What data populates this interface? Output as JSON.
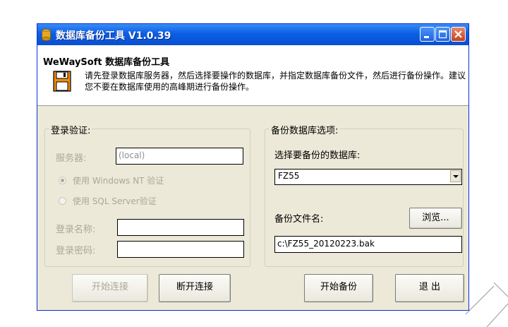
{
  "window": {
    "title": "数据库备份工具 V1.0.39"
  },
  "header": {
    "app_title": "WeWaySoft 数据库备份工具",
    "description": "请先登录数据库服务器，然后选择要操作的数据库，并指定数据库备份文件，然后进行备份操作。建议您不要在数据库使用的高峰期进行备份操作。"
  },
  "login": {
    "legend": "登录验证:",
    "server_label": "服务器:",
    "server_value": "(local)",
    "auth_windows": "使用 Windows NT 验证",
    "auth_sql": "使用 SQL Server验证",
    "username_label": "登录名称:",
    "username_value": "",
    "password_label": "登录密码:",
    "password_value": ""
  },
  "backup": {
    "legend": "备份数据库选项:",
    "select_db_label": "选择要备份的数据库:",
    "selected_db": "FZ55",
    "file_label": "备份文件名:",
    "browse_label": "浏览...",
    "file_value": "c:\\FZ55_20120223.bak"
  },
  "buttons": {
    "connect": "开始连接",
    "disconnect": "断开连接",
    "start_backup": "开始备份",
    "exit": "退 出"
  },
  "colors": {
    "titlebar": "#0a5fe6",
    "face": "#ece9d8",
    "disabled_text": "#aca899"
  }
}
